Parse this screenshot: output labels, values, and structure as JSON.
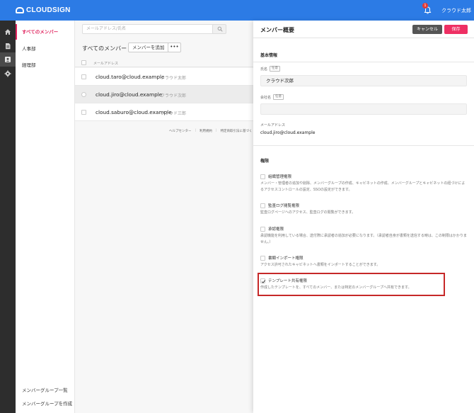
{
  "brand": {
    "logo_text": "CLOUDSIGN"
  },
  "topbar": {
    "notification_count": "1",
    "user_name": "クラウド太郎"
  },
  "sidebar": {
    "items": [
      {
        "label": "すべてのメンバー"
      },
      {
        "label": "人事部"
      },
      {
        "label": "経理部"
      }
    ],
    "bottom": [
      {
        "label": "メンバーグループ一覧"
      },
      {
        "label": "メンバーグループを作成"
      }
    ]
  },
  "list": {
    "search_placeholder": "メールアドレス/氏名",
    "title": "すべてのメンバー",
    "add_label": "メンバーを追加",
    "more_label": "•••",
    "column_header": "メールアドレス",
    "rows": [
      {
        "email": "cloud.taro@cloud.example",
        "name": "クラウド太郎"
      },
      {
        "email": "cloud.jiro@cloud.example",
        "name": "クラウド次郎"
      },
      {
        "email": "cloud.saburo@cloud.example",
        "name": "クラウド三郎"
      }
    ],
    "footer": [
      "ヘルプセンター",
      "利用規約",
      "特定商取引法に基づく"
    ]
  },
  "panel": {
    "title": "メンバー概要",
    "cancel_label": "キャンセル",
    "save_label": "保存",
    "basic_info": {
      "heading": "基本情報",
      "name_label": "氏名",
      "required_tag": "任意",
      "name_value": "クラウド次郎",
      "company_label": "会社名",
      "company_tag": "任意",
      "company_value": "",
      "email_label": "メールアドレス",
      "email_value": "cloud.jiro@cloud.example"
    },
    "permissions": {
      "heading": "権限",
      "items": [
        {
          "name": "組織管理権限",
          "desc": "メンバー・管理者の追加や削除、メンバーグループの作成、キャビネットの作成、メンバーグループとキャビネットの紐づけによるアクセスコントロールの設定、SSOの設定ができます。",
          "checked": false
        },
        {
          "name": "監査ログ閲覧権限",
          "desc": "監査ログページへのアクセス、監査ログの閲覧ができます。",
          "checked": false
        },
        {
          "name": "承認権限",
          "desc": "承認機能を利用している場合、送付際に承認者の追加が必要になります。（承認者自身が書類を送信する時は、この制限はかかりません。）",
          "checked": false
        },
        {
          "name": "書類インポート権限",
          "desc": "アクセス許可されたキャビネットへ書類をインポートすることができます。",
          "checked": false
        },
        {
          "name": "テンプレート共有権限",
          "desc": "作成したテンプレートを、すべてのメンバー、または特定のメンバーグループへ共有できます。",
          "checked": true
        }
      ]
    }
  },
  "colors": {
    "topbar": "#2c7be5",
    "accent": "#e0245e",
    "save": "#ee2f63",
    "highlight": "#c62828"
  }
}
